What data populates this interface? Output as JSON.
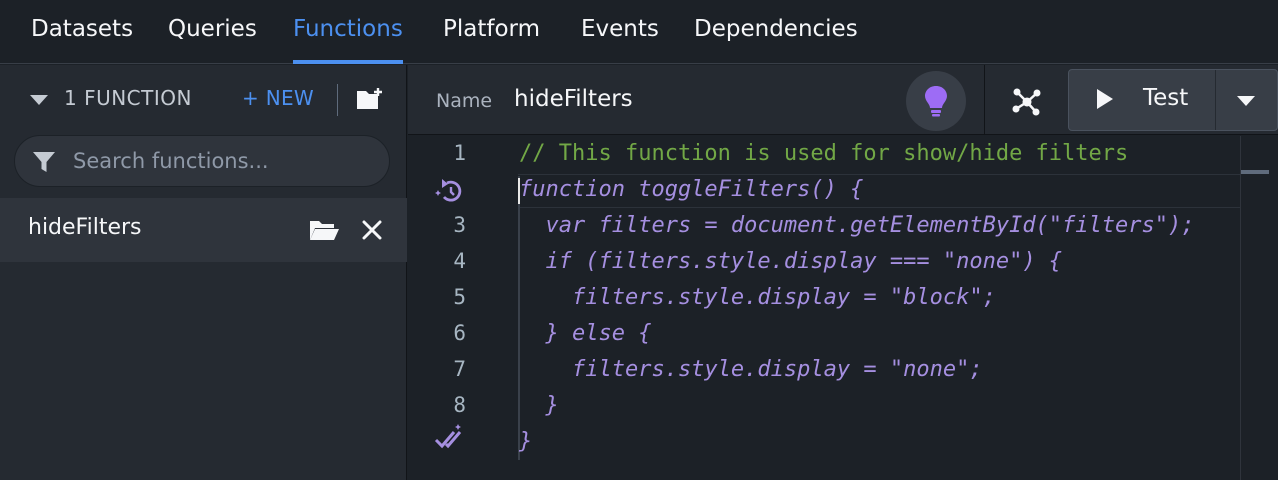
{
  "nav": {
    "tabs": [
      {
        "label": "Datasets"
      },
      {
        "label": "Queries"
      },
      {
        "label": "Functions"
      },
      {
        "label": "Platform"
      },
      {
        "label": "Events"
      },
      {
        "label": "Dependencies"
      }
    ],
    "active_tab": "Functions"
  },
  "sidebar": {
    "count_label": "1 FUNCTION",
    "new_label": "+ NEW",
    "search_placeholder": "Search functions...",
    "search_value": "",
    "functions": [
      {
        "name": "hideFilters"
      }
    ]
  },
  "editor": {
    "name_label": "Name",
    "name_value": "hideFilters",
    "test_label": "Test",
    "line_numbers": [
      "1",
      "3",
      "4",
      "5",
      "6",
      "7",
      "8"
    ],
    "lines": [
      "// This function is used for show/hide filters",
      "function toggleFilters() {",
      "  var filters = document.getElementById(\"filters\");",
      "  if (filters.style.display === \"none\") {",
      "    filters.style.display = \"block\";",
      "  } else {",
      "    filters.style.display = \"none\";",
      "  }",
      "}"
    ]
  },
  "colors": {
    "accent": "#4c90f0",
    "code_text": "#a58fe0",
    "comment": "#72a846",
    "bulb": "#9d6cf5"
  },
  "icons": [
    "folder-plus-icon",
    "filter-icon",
    "folder-open-icon",
    "close-icon",
    "lightbulb-icon",
    "graph-icon",
    "play-icon",
    "caret-down-icon",
    "reset-icon",
    "double-check-icon"
  ]
}
